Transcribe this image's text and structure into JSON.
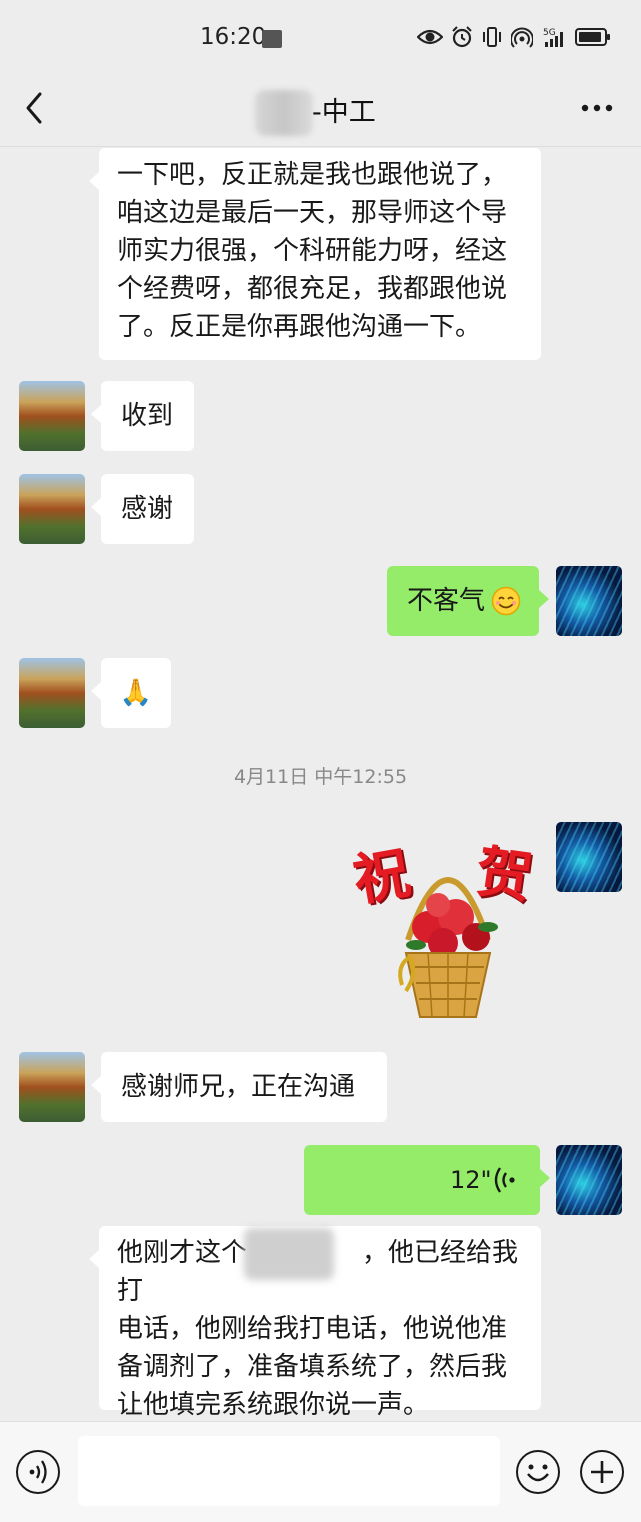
{
  "status_bar": {
    "time": "16:20",
    "network": "5G"
  },
  "header": {
    "title": "-中工"
  },
  "messages": {
    "m1": {
      "text": "一下吧，反正就是我也跟他说了，\n咱这边是最后一天，那导师这个导\n师实力很强，个科研能力呀，经这\n个经费呀，都很充足，我都跟他说\n了。反正是你再跟他沟通一下。"
    },
    "m2": {
      "text": "收到"
    },
    "m3": {
      "text": "感谢"
    },
    "m4": {
      "text": "不客气"
    },
    "m5": {
      "text": "🙏"
    },
    "timestamp": "4月11日 中午12:55",
    "sticker": {
      "line1": "祝",
      "line2": "贺"
    },
    "m7": {
      "text": "感谢师兄，正在沟通"
    },
    "m8": {
      "duration": "12\""
    },
    "m9": {
      "text_before_blur": "他刚才这个",
      "text_after_blur": "，他已经给我打\n电话，他刚给我打电话，他说他准\n备调剂了，准备填系统了，然后我\n让他填完系统跟你说一声。"
    }
  },
  "input_bar": {
    "placeholder": ""
  },
  "colors": {
    "outgoing_bubble": "#95ec69",
    "incoming_bubble": "#ffffff",
    "background": "#ededed"
  }
}
